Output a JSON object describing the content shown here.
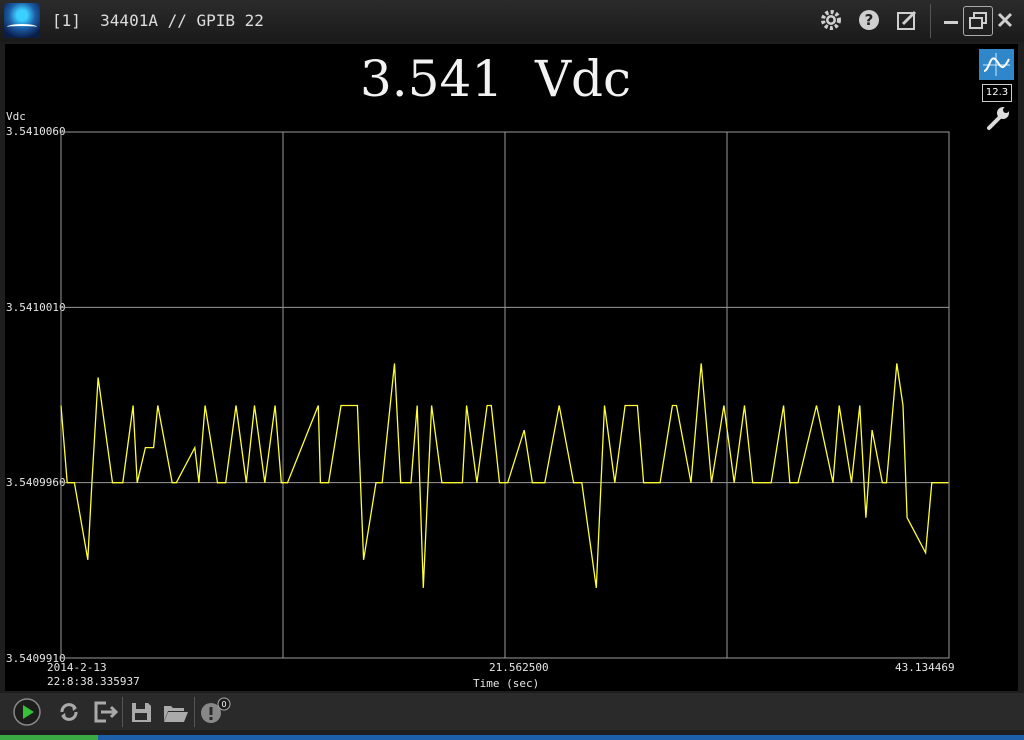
{
  "window": {
    "title": "[1]  34401A // GPIB 22"
  },
  "titlebar_icons": [
    "gear-icon",
    "help-icon",
    "edit-icon",
    "minimize-icon",
    "restore-icon",
    "close-icon"
  ],
  "display": {
    "value": "3.541",
    "unit": "Vdc"
  },
  "side_buttons": {
    "numeric_label": "12.3"
  },
  "chart_data": {
    "type": "line",
    "ylabel": "Vdc",
    "xlabel": "Time (sec)",
    "ylim": [
      3.540991,
      3.541006
    ],
    "xlim": [
      0,
      43.134469
    ],
    "y_ticks": [
      "3.5410060",
      "3.5410010",
      "3.5409960",
      "3.5409910"
    ],
    "x_tick_labels": {
      "start_date": "2014-2-13",
      "start_time": "22:8:38.335937",
      "mid": "21.562500",
      "end": "43.134469"
    },
    "grid": true,
    "colors": {
      "line": "#ffff33",
      "grid": "#9a9a9a",
      "background": "#000000"
    },
    "x": [
      0.0,
      0.3,
      0.65,
      1.3,
      1.5,
      1.8,
      2.5,
      3.0,
      3.5,
      3.7,
      4.1,
      4.5,
      4.7,
      5.4,
      5.6,
      6.5,
      6.7,
      7.0,
      7.6,
      8.0,
      8.5,
      9.0,
      9.4,
      9.9,
      10.4,
      10.7,
      11.0,
      12.5,
      12.6,
      13.0,
      13.6,
      14.4,
      14.7,
      15.3,
      15.6,
      16.2,
      16.5,
      17.0,
      17.3,
      17.6,
      18.0,
      18.5,
      19.5,
      19.7,
      20.2,
      20.7,
      20.9,
      21.3,
      21.7,
      22.5,
      22.9,
      23.5,
      24.2,
      24.9,
      25.3,
      26.0,
      26.4,
      26.9,
      27.4,
      28.0,
      28.3,
      29.1,
      29.7,
      29.9,
      30.6,
      31.1,
      31.6,
      32.2,
      32.7,
      33.2,
      33.6,
      34.5,
      35.1,
      35.4,
      35.8,
      36.7,
      37.5,
      37.8,
      38.4,
      38.8,
      39.1,
      39.4,
      39.9,
      40.1,
      40.6,
      40.9,
      41.1,
      42.0,
      42.3,
      43.1
    ],
    "y": [
      3.5409982,
      3.540996,
      3.540996,
      3.5409938,
      3.540996,
      3.540999,
      3.540996,
      3.540996,
      3.5409982,
      3.540996,
      3.540997,
      3.540997,
      3.5409982,
      3.540996,
      3.540996,
      3.540997,
      3.540996,
      3.5409982,
      3.540996,
      3.540996,
      3.5409982,
      3.540996,
      3.5409982,
      3.540996,
      3.5409982,
      3.540996,
      3.540996,
      3.5409982,
      3.540996,
      3.540996,
      3.5409982,
      3.5409982,
      3.5409938,
      3.540996,
      3.540996,
      3.5409994,
      3.540996,
      3.540996,
      3.5409982,
      3.540993,
      3.5409982,
      3.540996,
      3.540996,
      3.5409982,
      3.540996,
      3.5409982,
      3.5409982,
      3.540996,
      3.540996,
      3.5409975,
      3.540996,
      3.540996,
      3.5409982,
      3.540996,
      3.540996,
      3.540993,
      3.5409982,
      3.540996,
      3.5409982,
      3.5409982,
      3.540996,
      3.540996,
      3.5409982,
      3.5409982,
      3.540996,
      3.5409994,
      3.540996,
      3.5409982,
      3.540996,
      3.5409982,
      3.540996,
      3.540996,
      3.5409982,
      3.540996,
      3.540996,
      3.5409982,
      3.540996,
      3.5409982,
      3.540996,
      3.5409982,
      3.540995,
      3.5409975,
      3.540996,
      3.540996,
      3.5409994,
      3.5409982,
      3.540995,
      3.540994,
      3.540996,
      3.540996
    ]
  },
  "bottom_toolbar": {
    "badge_count": "0"
  }
}
